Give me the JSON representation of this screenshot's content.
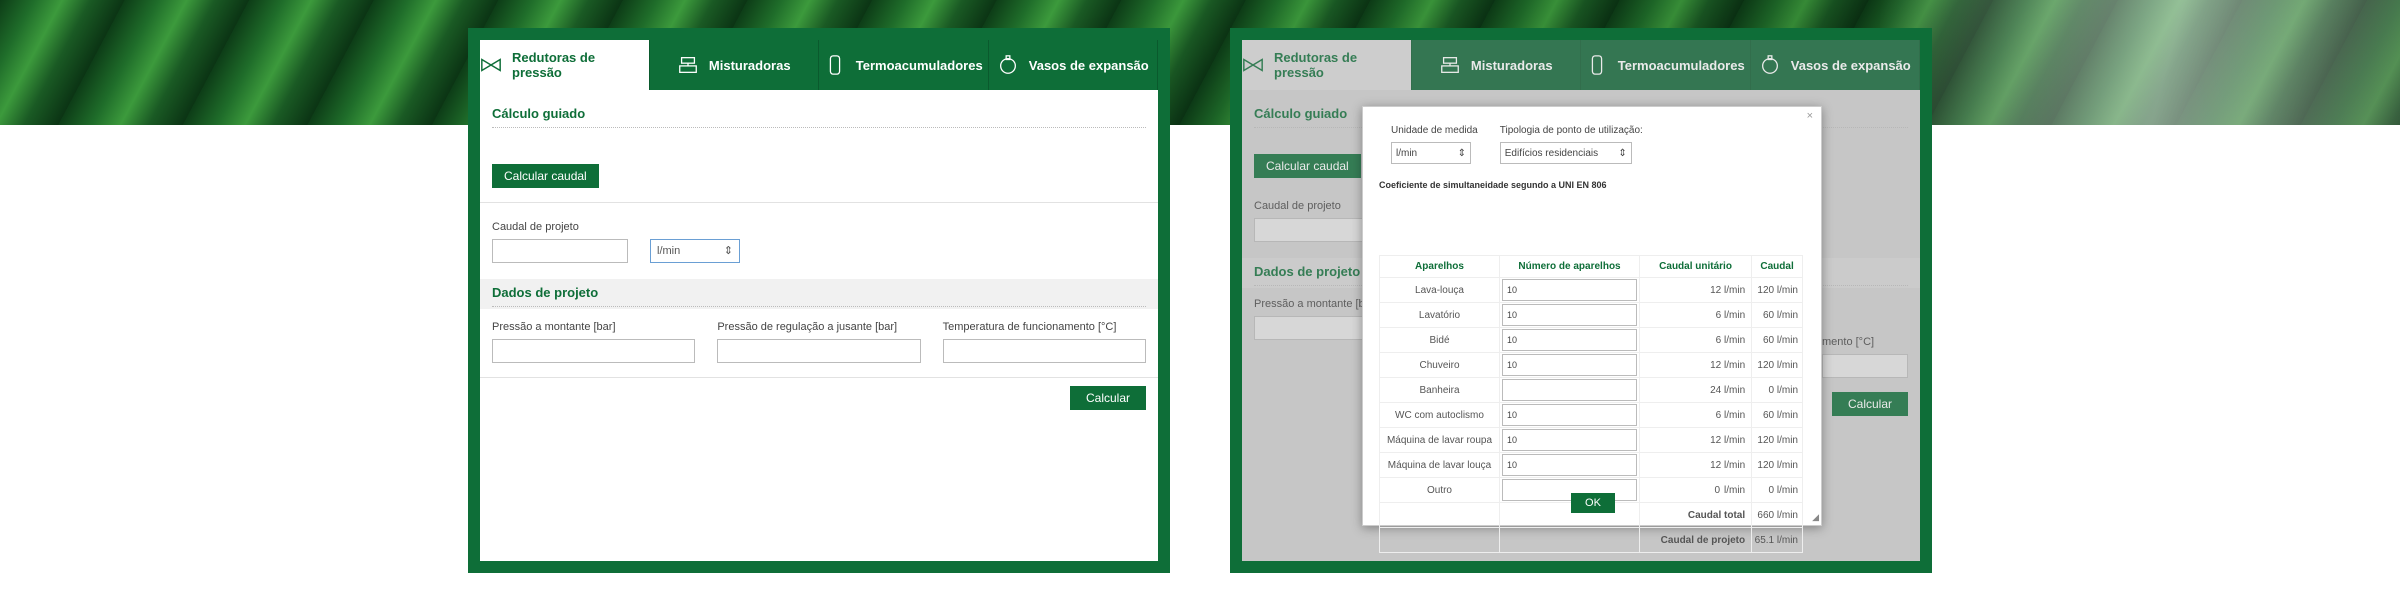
{
  "tabs": [
    {
      "label": "Redutoras de pressão",
      "icon": "valve-icon"
    },
    {
      "label": "Misturadoras",
      "icon": "mixer-icon"
    },
    {
      "label": "Termoacumuladores",
      "icon": "boiler-icon"
    },
    {
      "label": "Vasos de expansão",
      "icon": "expansion-vessel-icon"
    }
  ],
  "left": {
    "guided_title": "Cálculo guiado",
    "calc_flow_button": "Calcular caudal",
    "flow_label": "Caudal de projeto",
    "flow_value": "",
    "flow_unit": "l/min",
    "project_title": "Dados de projeto",
    "upstream_label": "Pressão a montante [bar]",
    "downstream_label": "Pressão de regulação a jusante [bar]",
    "temp_label": "Temperatura de funcionamento [°C]",
    "calculate_button": "Calcular"
  },
  "right": {
    "guided_title": "Cálculo guiado",
    "calc_flow_button": "Calcular caudal",
    "flow_label": "Caudal de projeto",
    "project_title": "Dados de projeto",
    "upstream_label": "Pressão a montante [b",
    "temp_label_partial": "mento [°C]",
    "calculate_button": "Calcular"
  },
  "modal": {
    "close": "×",
    "unit_label": "Unidade de medida",
    "unit_value": "l/min",
    "typology_label": "Tipologia de ponto de utilização:",
    "typology_value": "Edifícios residenciais",
    "coefficient_label": "Coeficiente de simultaneidade segundo a UNI EN 806",
    "headers": [
      "Aparelhos",
      "Número de aparelhos",
      "Caudal unitário",
      "Caudal"
    ],
    "rows": [
      {
        "name": "Lava-louça",
        "count": "10",
        "unit": "12 l/min",
        "flow": "120 l/min"
      },
      {
        "name": "Lavatório",
        "count": "10",
        "unit": "6 l/min",
        "flow": "60 l/min"
      },
      {
        "name": "Bidé",
        "count": "10",
        "unit": "6 l/min",
        "flow": "60 l/min"
      },
      {
        "name": "Chuveiro",
        "count": "10",
        "unit": "12 l/min",
        "flow": "120 l/min"
      },
      {
        "name": "Banheira",
        "count": "",
        "unit": "24 l/min",
        "flow": "0 l/min"
      },
      {
        "name": "WC com autoclismo",
        "count": "10",
        "unit": "6 l/min",
        "flow": "60 l/min"
      },
      {
        "name": "Máquina de lavar roupa",
        "count": "10",
        "unit": "12 l/min",
        "flow": "120 l/min"
      },
      {
        "name": "Máquina de lavar louça",
        "count": "10",
        "unit": "12 l/min",
        "flow": "120 l/min"
      }
    ],
    "other": {
      "name": "Outro",
      "count": "",
      "unit_value": "0",
      "unit_suffix": "l/min",
      "flow": "0 l/min"
    },
    "total_label": "Caudal total",
    "total_value": "660 l/min",
    "project_label": "Caudal de projeto",
    "project_value": "65.1 l/min",
    "ok_button": "OK"
  }
}
